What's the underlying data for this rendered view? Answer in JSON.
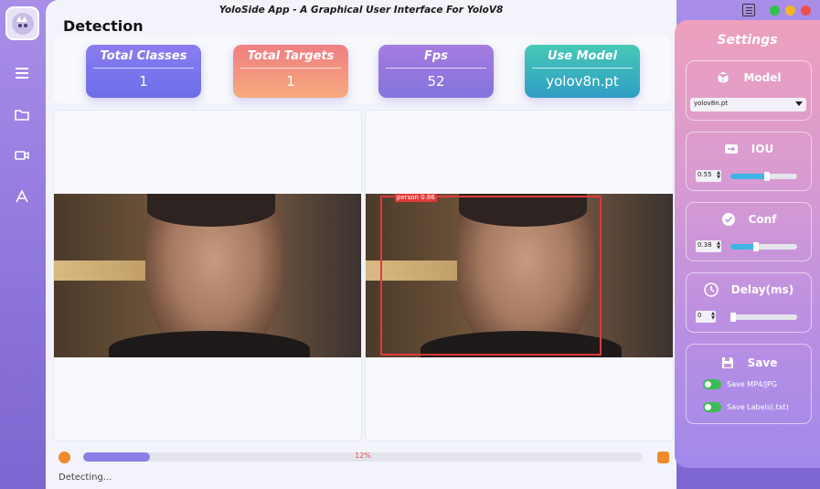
{
  "window": {
    "title": "YoloSide App  -  A Graphical User Interface For YoloV8"
  },
  "page": {
    "heading": "Detection"
  },
  "cards": [
    {
      "label": "Total Classes",
      "value": "1"
    },
    {
      "label": "Total Targets",
      "value": "1"
    },
    {
      "label": "Fps",
      "value": "52"
    },
    {
      "label": "Use Model",
      "value": "yolov8n.pt"
    }
  ],
  "rail": {
    "icons": [
      "menu-icon",
      "folder-icon",
      "camera-icon",
      "broadcast-icon"
    ]
  },
  "detection": {
    "box_label": "person  0.86"
  },
  "progress": {
    "value": 0.12,
    "text": "12%"
  },
  "status": {
    "text": "Detecting..."
  },
  "settings": {
    "title": "Settings",
    "model": {
      "label": "Model",
      "selected": "yolov8n.pt"
    },
    "iou": {
      "label": "IOU",
      "value": "0.55",
      "level": 0.55
    },
    "conf": {
      "label": "Conf",
      "value": "0.38",
      "level": 0.38
    },
    "delay": {
      "label": "Delay(ms)",
      "value": "0",
      "level": 0
    },
    "save": {
      "label": "Save",
      "mp4": "Save MP4/JPG",
      "labels": "Save Labels(.txt)"
    }
  },
  "colors": {
    "accent": "#8b7fe6",
    "orange": "#f08a2c",
    "toggle_on": "#3dbb57",
    "bbox": "#e03a3a"
  }
}
